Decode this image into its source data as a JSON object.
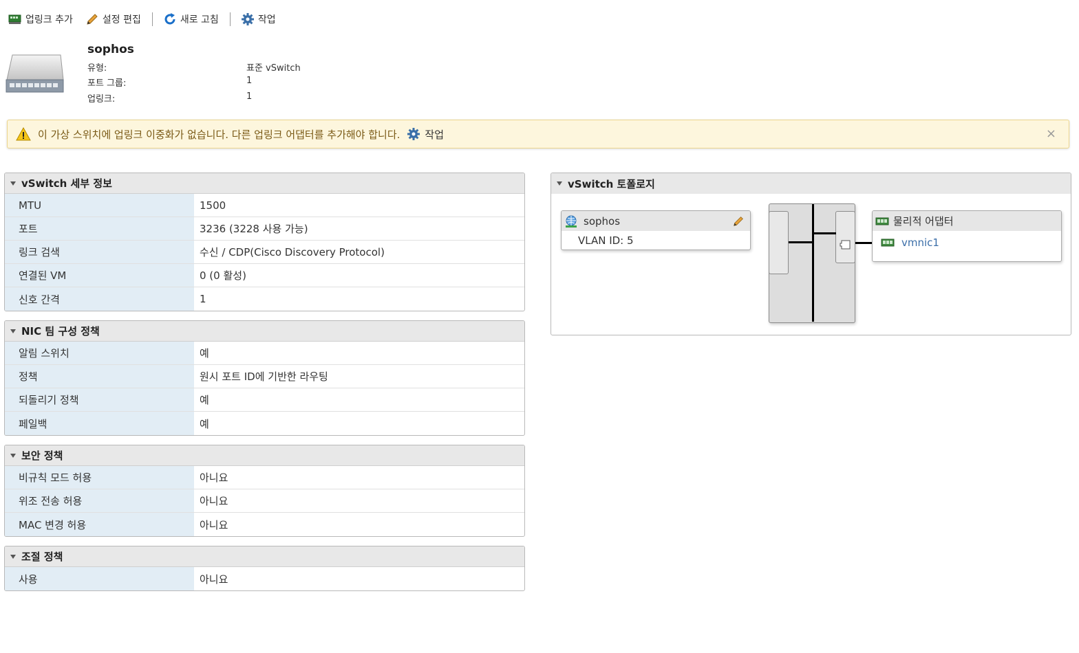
{
  "toolbar": {
    "add_uplink": "업링크 추가",
    "edit_settings": "설정 편집",
    "refresh": "새로 고침",
    "actions": "작업"
  },
  "header": {
    "name": "sophos",
    "type_label": "유형:",
    "type_value": "표준 vSwitch",
    "portgroups_label": "포트 그룹:",
    "portgroups_value": "1",
    "uplinks_label": "업링크:",
    "uplinks_value": "1"
  },
  "warning": {
    "text": "이 가상 스위치에 업링크 이중화가 없습니다. 다른 업링크 어댑터를 추가해야 합니다.",
    "action": "작업",
    "close": "×"
  },
  "panels": {
    "details": {
      "title": "vSwitch 세부 정보",
      "rows": [
        {
          "k": "MTU",
          "v": "1500"
        },
        {
          "k": "포트",
          "v": "3236 (3228 사용 가능)"
        },
        {
          "k": "링크 검색",
          "v": "수신 / CDP(Cisco Discovery Protocol)"
        },
        {
          "k": "연결된 VM",
          "v": "0 (0 활성)"
        },
        {
          "k": "신호 간격",
          "v": "1"
        }
      ]
    },
    "nic": {
      "title": "NIC 팀 구성 정책",
      "rows": [
        {
          "k": "알림 스위치",
          "v": "예"
        },
        {
          "k": "정책",
          "v": "원시 포트 ID에 기반한 라우팅"
        },
        {
          "k": "되돌리기 정책",
          "v": "예"
        },
        {
          "k": "페일백",
          "v": "예"
        }
      ]
    },
    "security": {
      "title": "보안 정책",
      "rows": [
        {
          "k": "비규칙 모드 허용",
          "v": "아니요"
        },
        {
          "k": "위조 전송 허용",
          "v": "아니요"
        },
        {
          "k": "MAC 변경 허용",
          "v": "아니요"
        }
      ]
    },
    "shaping": {
      "title": "조절 정책",
      "rows": [
        {
          "k": "사용",
          "v": "아니요"
        }
      ]
    }
  },
  "topology": {
    "title": "vSwitch 토폴로지",
    "portgroup_name": "sophos",
    "portgroup_vlan": "VLAN ID: 5",
    "adapters_title": "물리적 어댑터",
    "adapter_name": "vmnic1"
  },
  "icons": {
    "add_uplink": "network-card-add-icon",
    "edit": "pencil-icon",
    "refresh": "refresh-icon",
    "actions": "gear-icon",
    "warning": "warning-triangle-icon",
    "portgroup": "globe-network-icon",
    "adapter": "network-card-icon"
  },
  "colors": {
    "warning_bg": "#fdf6dd",
    "warning_text": "#7a5a16",
    "key_cell_bg": "#e2edf5",
    "link": "#3b6ea8"
  }
}
